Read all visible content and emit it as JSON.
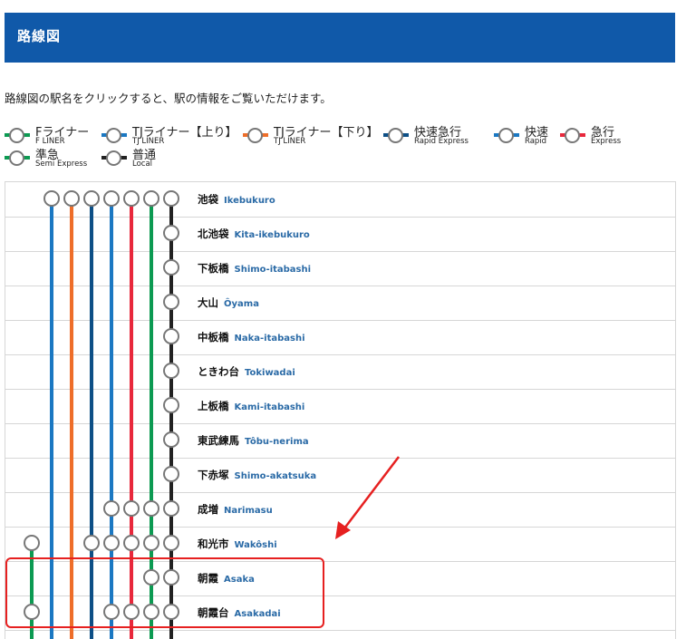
{
  "header": {
    "title": "路線図"
  },
  "instruction": "路線図の駅名をクリックすると、駅の情報をご覧いただけます。",
  "legend": [
    {
      "jp": "Fライナー",
      "en": "F LINER",
      "color": "#0c9a52"
    },
    {
      "jp": "TJライナー【上り】",
      "en": "TJ LINER",
      "color": "#1b78c2"
    },
    {
      "jp": "TJライナー【下り】",
      "en": "TJ LINER",
      "color": "#ee6e2a"
    },
    {
      "jp": "快速急行",
      "en": "Rapid Express",
      "color": "#0d4f86"
    },
    {
      "jp": "快速",
      "en": "Rapid",
      "color": "#1b78c2"
    },
    {
      "jp": "急行",
      "en": "Express",
      "color": "#e8283c"
    },
    {
      "jp": "準急",
      "en": "Semi Express",
      "color": "#0c9a52"
    },
    {
      "jp": "普通",
      "en": "Local",
      "color": "#222222"
    }
  ],
  "lines": [
    {
      "name": "F LINER",
      "color": "#0c9a52"
    },
    {
      "name": "TJ LINER",
      "color": "#1b78c2"
    },
    {
      "name": "TJ LINER",
      "color": "#ee6e2a"
    },
    {
      "name": "Rapid Express",
      "color": "#0d4f86"
    },
    {
      "name": "Rapid",
      "color": "#1b78c2"
    },
    {
      "name": "Express",
      "color": "#e8283c"
    },
    {
      "name": "Semi Express",
      "color": "#0c9a52"
    },
    {
      "name": "Local",
      "color": "#222222"
    }
  ],
  "stations": [
    {
      "jp": "池袋",
      "en": "Ikebukuro",
      "stops": [
        false,
        true,
        true,
        true,
        true,
        true,
        true,
        true
      ]
    },
    {
      "jp": "北池袋",
      "en": "Kita-ikebukuro",
      "stops": [
        false,
        false,
        false,
        false,
        false,
        false,
        false,
        true
      ]
    },
    {
      "jp": "下板橋",
      "en": "Shimo-itabashi",
      "stops": [
        false,
        false,
        false,
        false,
        false,
        false,
        false,
        true
      ]
    },
    {
      "jp": "大山",
      "en": "Ôyama",
      "stops": [
        false,
        false,
        false,
        false,
        false,
        false,
        false,
        true
      ]
    },
    {
      "jp": "中板橋",
      "en": "Naka-itabashi",
      "stops": [
        false,
        false,
        false,
        false,
        false,
        false,
        false,
        true
      ]
    },
    {
      "jp": "ときわ台",
      "en": "Tokiwadai",
      "stops": [
        false,
        false,
        false,
        false,
        false,
        false,
        false,
        true
      ]
    },
    {
      "jp": "上板橋",
      "en": "Kami-itabashi",
      "stops": [
        false,
        false,
        false,
        false,
        false,
        false,
        false,
        true
      ]
    },
    {
      "jp": "東武練馬",
      "en": "Tôbu-nerima",
      "stops": [
        false,
        false,
        false,
        false,
        false,
        false,
        false,
        true
      ]
    },
    {
      "jp": "下赤塚",
      "en": "Shimo-akatsuka",
      "stops": [
        false,
        false,
        false,
        false,
        false,
        false,
        false,
        true
      ]
    },
    {
      "jp": "成増",
      "en": "Narimasu",
      "stops": [
        false,
        false,
        false,
        false,
        true,
        true,
        true,
        true
      ]
    },
    {
      "jp": "和光市",
      "en": "Wakôshi",
      "stops": [
        true,
        false,
        false,
        true,
        true,
        true,
        true,
        true
      ]
    },
    {
      "jp": "朝霞",
      "en": "Asaka",
      "stops": [
        false,
        false,
        false,
        false,
        false,
        false,
        true,
        true
      ]
    },
    {
      "jp": "朝霞台",
      "en": "Asakadai",
      "stops": [
        true,
        false,
        false,
        false,
        true,
        true,
        true,
        true
      ]
    }
  ]
}
